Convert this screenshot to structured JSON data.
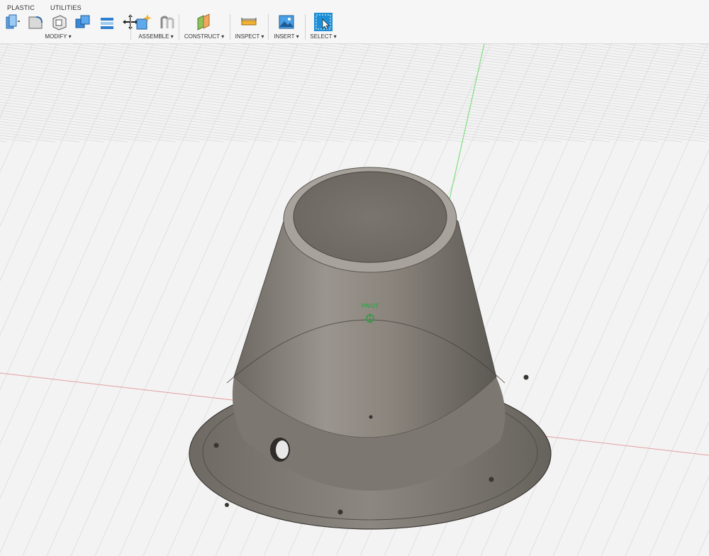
{
  "tabs": {
    "plastic": "PLASTIC",
    "utilities": "UTILITIES"
  },
  "groups": {
    "modify": "MODIFY ▾",
    "assemble": "ASSEMBLE ▾",
    "construct": "CONSTRUCT ▾",
    "inspect": "INSPECT ▾",
    "insert": "INSERT ▾",
    "select": "SELECT ▾"
  },
  "icons": {
    "modify": [
      "press-pull-icon",
      "fillet-icon",
      "shell-icon",
      "combine-icon",
      "stack-icon",
      "move-icon"
    ],
    "assemble": [
      "new-component-icon",
      "joint-icon"
    ],
    "construct": [
      "offset-plane-icon"
    ],
    "inspect": [
      "measure-icon"
    ],
    "insert": [
      "insert-image-icon"
    ],
    "select": [
      "select-icon"
    ]
  },
  "viewport": {
    "pivot_label": "PIVOT"
  },
  "colors": {
    "accent": "#1e8fd6",
    "grid": "#d8d8d8",
    "x_axis": "#e07a7a",
    "y_axis": "#6cd66c",
    "body": "#8a847c"
  }
}
